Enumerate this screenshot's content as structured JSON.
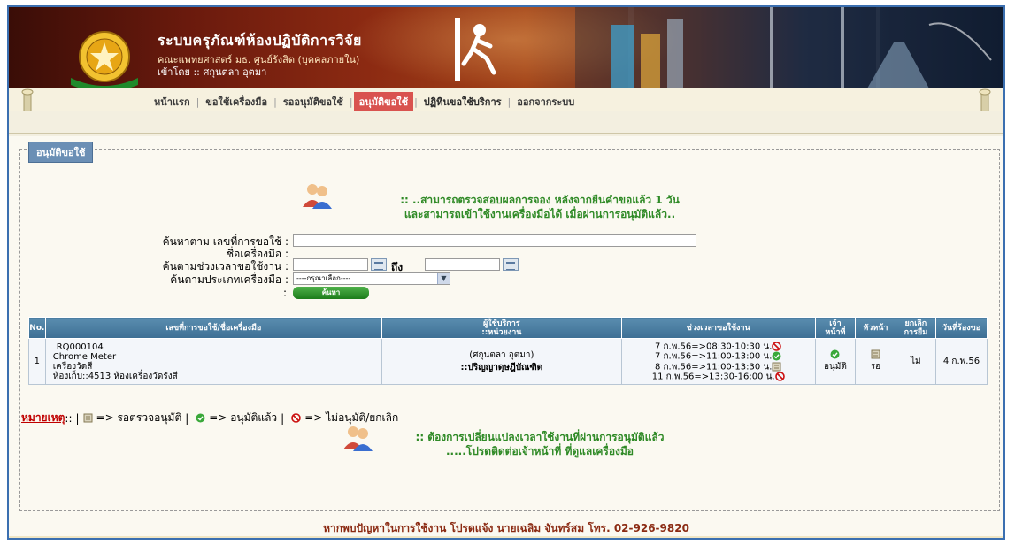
{
  "header": {
    "system_title": "ระบบครุภัณฑ์ห้องปฏิบัติการวิจัย",
    "subtitle": "คณะแพทยศาสตร์ มธ. ศูนย์รังสิต (บุคคลภายใน)",
    "user_line": "เข้าโดย :: ศกุนตลา อุตมา"
  },
  "menu": {
    "items": [
      "หน้าแรก",
      "ขอใช้เครื่องมือ",
      "รออนุมัติขอใช้",
      "อนุมัติขอใช้",
      "ปฏิทินขอใช้บริการ",
      "ออกจากระบบ"
    ],
    "active_index": 3
  },
  "section": {
    "legend": "อนุมัติขอใช้",
    "notice_line1": ":: ..สามารถตรวจสอบผลการจอง หลังจากยืนคำขอแล้ว 1 วัน",
    "notice_line2": "และสามารถเข้าใช้งานเครื่องมือได้ เมื่อผ่านการอนุมัติแล้ว.."
  },
  "search": {
    "label_request": "ค้นหาตาม เลขที่การขอใช้ :",
    "label_tool": "ชื่อเครื่องมือ :",
    "label_period": "ค้นตามช่วงเวลาขอใช้งาน :",
    "to_label": "ถึง",
    "label_type": "ค้นตามประเภทเครื่องมือ :",
    "select_value": "----กรุณาเลือก----",
    "colon": ":",
    "button": "ค้นหา"
  },
  "table": {
    "headers": [
      "No.",
      "เลขที่การขอใช้/ชื่อเครื่องมือ",
      "ผู้ใช้บริการ",
      "::หน่วยงาน",
      "ช่วงเวลาขอใช้งาน",
      "เจ้า",
      "หน้าที่",
      "หัวหน้า",
      "ยกเลิก",
      "การยืม",
      "วันที่ร้องขอ"
    ],
    "rows": [
      {
        "no": "1",
        "request_id": "RQ000104",
        "tool": "Chrome Meter",
        "lab": "เครื่องวัดสี",
        "room": "ห้องเก็บ::4513 ห้องเครื่องวัดรังสี",
        "user": "(ศกุนตลา อุตมา)",
        "unit": "::ปริญญาดุษฎีบัณฑิต",
        "times": [
          {
            "text": "7 ก.พ.56=>08:30-10:30 น.",
            "status": "reject"
          },
          {
            "text": "7 ก.พ.56=>11:00-13:00 น.",
            "status": "approved"
          },
          {
            "text": "8 ก.พ.56=>11:00-13:30 น.",
            "status": "pending"
          },
          {
            "text": "11 ก.พ.56=>13:30-16:00 น.",
            "status": "reject"
          }
        ],
        "officer": "อนุมัติ",
        "head": "รอ",
        "cancel": "ไม่",
        "date": "4 ก.พ.56"
      }
    ]
  },
  "note": {
    "label": "หมายเหตุ",
    "label_colons": "::",
    "pending": "=> รอตรวจอนุมัติ",
    "approved": "=> อนุมัติแล้ว",
    "rejected": "=> ไม่อนุมัติ/ยกเลิก",
    "sep": "|"
  },
  "notice2": {
    "line1": ":: ต้องการเปลี่ยนแปลงเวลาใช้งานที่ผ่านการอนุมัติแล้ว",
    "line2": ".....โปรดติดต่อเจ้าหน้าที่ ที่ดูแลเครื่องมือ"
  },
  "footer": {
    "text": "หากพบปัญหาในการใช้งาน โปรดแจ้ง นายเฉลิม จันทร์สม โทร. 02-926-9820"
  },
  "colors": {
    "accent": "#d9534f",
    "table_header": "#3d6f94",
    "notice_green": "#2f8a26",
    "footer": "#8b2a12"
  }
}
